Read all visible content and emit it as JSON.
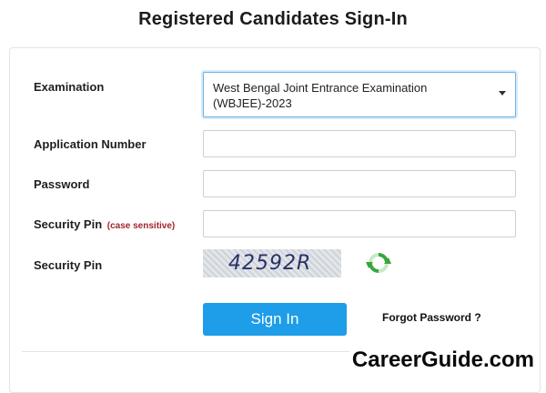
{
  "page": {
    "title": "Registered Candidates Sign-In"
  },
  "form": {
    "examination_label": "Examination",
    "examination_selected": "West Bengal Joint Entrance Examination (WBJEE)-2023",
    "application_number_label": "Application Number",
    "application_number_value": "",
    "password_label": "Password",
    "password_value": "",
    "security_pin_label": "Security Pin",
    "security_pin_note": "(case sensitive)",
    "security_pin_value": "",
    "captcha_label": "Security Pin",
    "captcha_text": "42592R",
    "signin_label": "Sign In",
    "forgot_label": "Forgot Password ?"
  },
  "watermark": "CareerGuide.com",
  "colors": {
    "primary": "#1e9de8",
    "note": "#a3262a",
    "refresh": "#3aa63a"
  },
  "icons": {
    "refresh": "refresh-icon",
    "caret": "chevron-down-icon"
  }
}
